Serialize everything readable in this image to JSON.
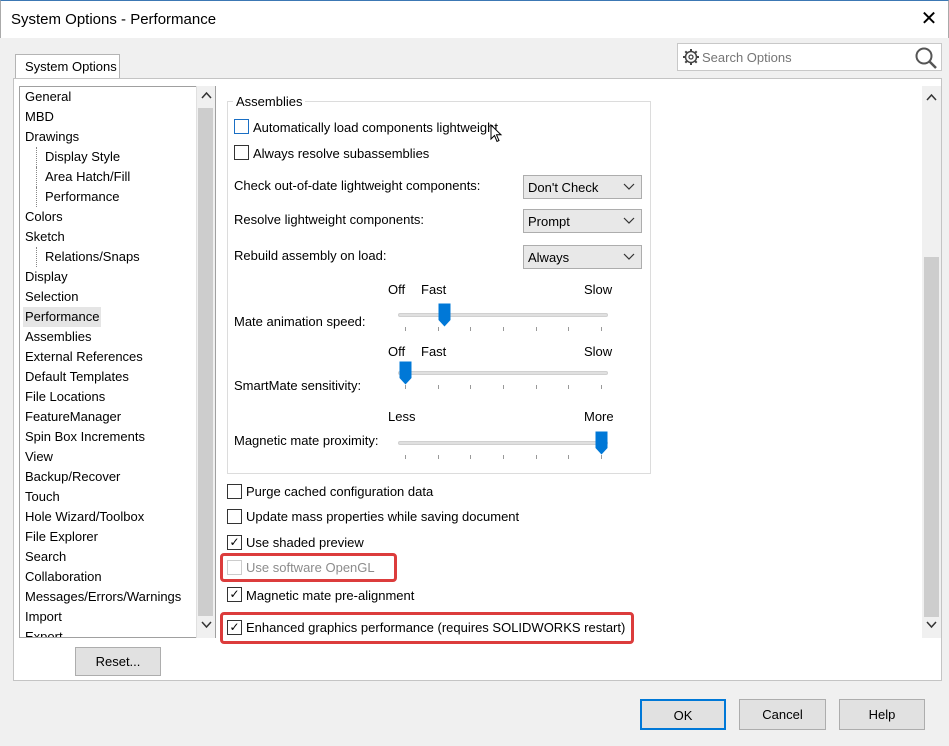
{
  "window": {
    "title": "System Options - Performance",
    "close_glyph": "✕"
  },
  "tab": {
    "label": "System Options"
  },
  "search": {
    "placeholder": "Search Options"
  },
  "tree": {
    "items": [
      {
        "label": "General",
        "level": 0
      },
      {
        "label": "MBD",
        "level": 0
      },
      {
        "label": "Drawings",
        "level": 0
      },
      {
        "label": "Display Style",
        "level": 1
      },
      {
        "label": "Area Hatch/Fill",
        "level": 1
      },
      {
        "label": "Performance",
        "level": 1
      },
      {
        "label": "Colors",
        "level": 0
      },
      {
        "label": "Sketch",
        "level": 0
      },
      {
        "label": "Relations/Snaps",
        "level": 1
      },
      {
        "label": "Display",
        "level": 0
      },
      {
        "label": "Selection",
        "level": 0
      },
      {
        "label": "Performance",
        "level": 0,
        "selected": true
      },
      {
        "label": "Assemblies",
        "level": 0
      },
      {
        "label": "External References",
        "level": 0
      },
      {
        "label": "Default Templates",
        "level": 0
      },
      {
        "label": "File Locations",
        "level": 0
      },
      {
        "label": "FeatureManager",
        "level": 0
      },
      {
        "label": "Spin Box Increments",
        "level": 0
      },
      {
        "label": "View",
        "level": 0
      },
      {
        "label": "Backup/Recover",
        "level": 0
      },
      {
        "label": "Touch",
        "level": 0
      },
      {
        "label": "Hole Wizard/Toolbox",
        "level": 0
      },
      {
        "label": "File Explorer",
        "level": 0
      },
      {
        "label": "Search",
        "level": 0
      },
      {
        "label": "Collaboration",
        "level": 0
      },
      {
        "label": "Messages/Errors/Warnings",
        "level": 0
      },
      {
        "label": "Import",
        "level": 0
      },
      {
        "label": "Export",
        "level": 0
      }
    ]
  },
  "reset_button": {
    "label": "Reset..."
  },
  "assemblies": {
    "title": "Assemblies",
    "auto_load_lightweight": {
      "label": "Automatically load components lightweight",
      "checked": false
    },
    "always_resolve": {
      "label": "Always resolve subassemblies",
      "checked": false
    },
    "check_out_of_date": {
      "label": "Check out-of-date lightweight components:",
      "value": "Don't Check"
    },
    "resolve_lightweight": {
      "label": "Resolve lightweight components:",
      "value": "Prompt"
    },
    "rebuild_on_load": {
      "label": "Rebuild assembly on load:",
      "value": "Always"
    },
    "mate_animation": {
      "label": "Mate animation speed:",
      "off": "Off",
      "fast": "Fast",
      "slow": "Slow",
      "level": 0.2
    },
    "smartmate": {
      "label": "SmartMate sensitivity:",
      "off": "Off",
      "fast": "Fast",
      "slow": "Slow",
      "level": 0.0
    },
    "magnetic_proximity": {
      "label": "Magnetic mate proximity:",
      "less": "Less",
      "more": "More",
      "level": 1.0
    }
  },
  "options": {
    "purge_cached": {
      "label": "Purge cached configuration data",
      "checked": false
    },
    "update_mass": {
      "label": "Update mass properties while saving document",
      "checked": false
    },
    "shaded_preview": {
      "label": "Use shaded preview",
      "checked": true
    },
    "software_opengl": {
      "label": "Use software OpenGL",
      "checked": false,
      "disabled": true
    },
    "magnetic_prealign": {
      "label": "Magnetic mate pre-alignment",
      "checked": true
    },
    "enhanced_graphics": {
      "label": "Enhanced graphics performance (requires SOLIDWORKS restart)",
      "checked": true
    }
  },
  "footer": {
    "ok": "OK",
    "cancel": "Cancel",
    "help": "Help"
  },
  "colors": {
    "accent": "#0078d7",
    "highlight": "#dc3c3c"
  }
}
